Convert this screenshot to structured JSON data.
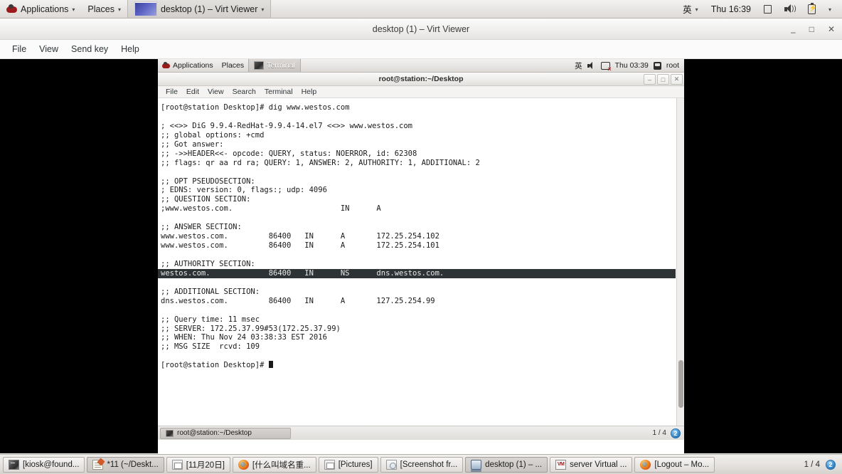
{
  "host_panel": {
    "logo_icon": "redhat-logo-icon",
    "menus": [
      {
        "label": "Applications",
        "icon": "redhat-logo-icon",
        "caret": "▾"
      },
      {
        "label": "Places",
        "caret": "▾"
      }
    ],
    "active_window": {
      "label": "desktop (1) – Virt Viewer",
      "caret": "▾",
      "icon": "virt-viewer-thumbnail-icon"
    },
    "indicators": {
      "input_method": "英",
      "input_caret": "▾",
      "clock": "Thu 16:39",
      "display_icon": "display-icon",
      "volume_icon": "volume-icon",
      "battery_icon": "battery-icon",
      "menu_caret": "▾"
    }
  },
  "virt_viewer": {
    "title": "desktop (1) – Virt Viewer",
    "window_buttons": {
      "minimize": "–",
      "maximize": "□",
      "close": "✕"
    },
    "menus": [
      "File",
      "View",
      "Send key",
      "Help"
    ]
  },
  "guest": {
    "panel": {
      "applications": "Applications",
      "places": "Places",
      "window_title": "Terminal",
      "input_method": "英",
      "clock": "Thu 03:39",
      "user": "root",
      "volume_icon": "volume-icon",
      "network_icon": "network-disconnected-icon",
      "user_icon": "user-icon",
      "logo_icon": "redhat-logo-icon",
      "terminal_icon": "terminal-icon"
    },
    "terminal": {
      "title": "root@station:~/Desktop",
      "window_buttons": {
        "minimize": "–",
        "maximize": "□",
        "close": "✕"
      },
      "menus": [
        "File",
        "Edit",
        "View",
        "Search",
        "Terminal",
        "Help"
      ],
      "lines": [
        {
          "text": "[root@station Desktop]# dig www.westos.com",
          "highlight": false
        },
        {
          "text": "",
          "highlight": false
        },
        {
          "text": "; <<>> DiG 9.9.4-RedHat-9.9.4-14.el7 <<>> www.westos.com",
          "highlight": false
        },
        {
          "text": ";; global options: +cmd",
          "highlight": false
        },
        {
          "text": ";; Got answer:",
          "highlight": false
        },
        {
          "text": ";; ->>HEADER<<- opcode: QUERY, status: NOERROR, id: 62308",
          "highlight": false
        },
        {
          "text": ";; flags: qr aa rd ra; QUERY: 1, ANSWER: 2, AUTHORITY: 1, ADDITIONAL: 2",
          "highlight": false
        },
        {
          "text": "",
          "highlight": false
        },
        {
          "text": ";; OPT PSEUDOSECTION:",
          "highlight": false
        },
        {
          "text": "; EDNS: version: 0, flags:; udp: 4096",
          "highlight": false
        },
        {
          "text": ";; QUESTION SECTION:",
          "highlight": false
        },
        {
          "text": ";www.westos.com.                        IN      A",
          "highlight": false
        },
        {
          "text": "",
          "highlight": false
        },
        {
          "text": ";; ANSWER SECTION:",
          "highlight": false
        },
        {
          "text": "www.westos.com.         86400   IN      A       172.25.254.102",
          "highlight": false
        },
        {
          "text": "www.westos.com.         86400   IN      A       172.25.254.101",
          "highlight": false
        },
        {
          "text": "",
          "highlight": false
        },
        {
          "text": ";; AUTHORITY SECTION:",
          "highlight": false
        },
        {
          "text": "westos.com.             86400   IN      NS      dns.westos.com.",
          "highlight": true
        },
        {
          "text": "",
          "highlight": false
        },
        {
          "text": ";; ADDITIONAL SECTION:",
          "highlight": false
        },
        {
          "text": "dns.westos.com.         86400   IN      A       127.25.254.99",
          "highlight": false
        },
        {
          "text": "",
          "highlight": false
        },
        {
          "text": ";; Query time: 11 msec",
          "highlight": false
        },
        {
          "text": ";; SERVER: 172.25.37.99#53(172.25.37.99)",
          "highlight": false
        },
        {
          "text": ";; WHEN: Thu Nov 24 03:38:33 EST 2016",
          "highlight": false
        },
        {
          "text": ";; MSG SIZE  rcvd: 109",
          "highlight": false
        },
        {
          "text": "",
          "highlight": false
        }
      ],
      "prompt": "[root@station Desktop]# "
    },
    "statusbar": {
      "task_label": "root@station:~/Desktop",
      "task_icon": "terminal-icon",
      "workspace_label": "1 / 4",
      "workspace_badge": "2"
    }
  },
  "host_taskbar": {
    "tasks": [
      {
        "label": "[kiosk@found...",
        "icon": "terminal-icon",
        "selected": false
      },
      {
        "label": "*11 (~/Deskt...",
        "icon": "text-editor-icon",
        "selected": true
      },
      {
        "label": "[11月20日]",
        "icon": "document-icon",
        "selected": false
      },
      {
        "label": "[什么叫域名重...",
        "icon": "firefox-icon",
        "selected": false
      },
      {
        "label": "[Pictures]",
        "icon": "document-icon",
        "selected": false
      },
      {
        "label": "[Screenshot fr...",
        "icon": "screenshot-icon",
        "selected": false
      },
      {
        "label": "desktop (1) – ...",
        "icon": "monitor-icon",
        "selected": true
      },
      {
        "label": "server Virtual ...",
        "icon": "virtual-machine-icon",
        "selected": false
      },
      {
        "label": "[Logout – Mo...",
        "icon": "firefox-icon",
        "selected": false
      }
    ],
    "workspace_label": "1 / 4",
    "workspace_badge": "2"
  },
  "colors": {
    "terminal_bg": "#ffffff",
    "terminal_fg": "#1a1a1a",
    "selection_bg": "#2e3436",
    "selection_fg": "#e8e8e8",
    "panel_bg": "#e6e4e2",
    "canvas_bg": "#000000"
  }
}
